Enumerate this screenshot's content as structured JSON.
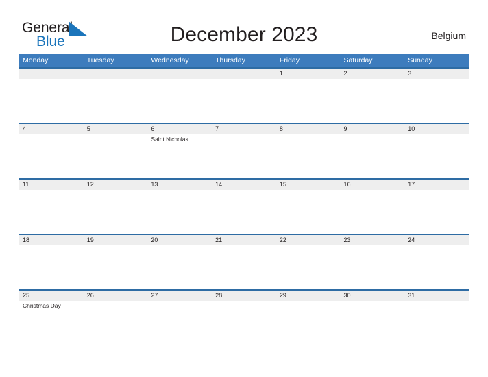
{
  "brand": {
    "name_part1": "General",
    "name_part2": "Blue",
    "flag_icon": "blue-triangle-flag-icon",
    "color_primary": "#1b75bb",
    "color_text": "#231f20"
  },
  "header": {
    "title": "December 2023",
    "region": "Belgium"
  },
  "calendar": {
    "month": "December",
    "year": "2023",
    "week_start": "Monday",
    "header_bg": "#3d7cbd",
    "date_strip_bg": "#eeeeee",
    "row_border": "#2e6ca4",
    "day_names": [
      "Monday",
      "Tuesday",
      "Wednesday",
      "Thursday",
      "Friday",
      "Saturday",
      "Sunday"
    ],
    "weeks": [
      [
        {
          "date": "",
          "events": []
        },
        {
          "date": "",
          "events": []
        },
        {
          "date": "",
          "events": []
        },
        {
          "date": "",
          "events": []
        },
        {
          "date": "1",
          "events": []
        },
        {
          "date": "2",
          "events": []
        },
        {
          "date": "3",
          "events": []
        }
      ],
      [
        {
          "date": "4",
          "events": []
        },
        {
          "date": "5",
          "events": []
        },
        {
          "date": "6",
          "events": [
            "Saint Nicholas"
          ]
        },
        {
          "date": "7",
          "events": []
        },
        {
          "date": "8",
          "events": []
        },
        {
          "date": "9",
          "events": []
        },
        {
          "date": "10",
          "events": []
        }
      ],
      [
        {
          "date": "11",
          "events": []
        },
        {
          "date": "12",
          "events": []
        },
        {
          "date": "13",
          "events": []
        },
        {
          "date": "14",
          "events": []
        },
        {
          "date": "15",
          "events": []
        },
        {
          "date": "16",
          "events": []
        },
        {
          "date": "17",
          "events": []
        }
      ],
      [
        {
          "date": "18",
          "events": []
        },
        {
          "date": "19",
          "events": []
        },
        {
          "date": "20",
          "events": []
        },
        {
          "date": "21",
          "events": []
        },
        {
          "date": "22",
          "events": []
        },
        {
          "date": "23",
          "events": []
        },
        {
          "date": "24",
          "events": []
        }
      ],
      [
        {
          "date": "25",
          "events": [
            "Christmas Day"
          ]
        },
        {
          "date": "26",
          "events": []
        },
        {
          "date": "27",
          "events": []
        },
        {
          "date": "28",
          "events": []
        },
        {
          "date": "29",
          "events": []
        },
        {
          "date": "30",
          "events": []
        },
        {
          "date": "31",
          "events": []
        }
      ]
    ]
  }
}
